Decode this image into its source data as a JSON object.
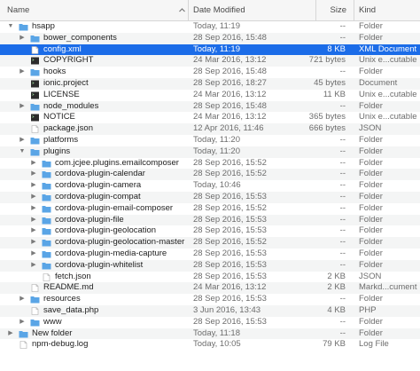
{
  "columns": {
    "name": "Name",
    "date": "Date Modified",
    "size": "Size",
    "kind": "Kind"
  },
  "rows": [
    {
      "name": "hsapp",
      "date": "Today, 11:19",
      "size": "--",
      "kind": "Folder",
      "icon": "folder-icon",
      "depth": 0,
      "expander": "open"
    },
    {
      "name": "bower_components",
      "date": "28 Sep 2016, 15:48",
      "size": "--",
      "kind": "Folder",
      "icon": "folder-icon",
      "depth": 1,
      "expander": "closed"
    },
    {
      "name": "config.xml",
      "date": "Today, 11:19",
      "size": "8 KB",
      "kind": "XML Document",
      "icon": "document-icon",
      "depth": 1,
      "expander": "none",
      "selected": true
    },
    {
      "name": "COPYRIGHT",
      "date": "24 Mar 2016, 13:12",
      "size": "721 bytes",
      "kind": "Unix e...cutable",
      "icon": "terminal-icon",
      "depth": 1,
      "expander": "none"
    },
    {
      "name": "hooks",
      "date": "28 Sep 2016, 15:48",
      "size": "--",
      "kind": "Folder",
      "icon": "folder-icon",
      "depth": 1,
      "expander": "closed"
    },
    {
      "name": "ionic.project",
      "date": "28 Sep 2016, 18:27",
      "size": "45 bytes",
      "kind": "Document",
      "icon": "terminal-icon",
      "depth": 1,
      "expander": "none"
    },
    {
      "name": "LICENSE",
      "date": "24 Mar 2016, 13:12",
      "size": "11 KB",
      "kind": "Unix e...cutable",
      "icon": "terminal-icon",
      "depth": 1,
      "expander": "none"
    },
    {
      "name": "node_modules",
      "date": "28 Sep 2016, 15:48",
      "size": "--",
      "kind": "Folder",
      "icon": "folder-icon",
      "depth": 1,
      "expander": "closed"
    },
    {
      "name": "NOTICE",
      "date": "24 Mar 2016, 13:12",
      "size": "365 bytes",
      "kind": "Unix e...cutable",
      "icon": "terminal-icon",
      "depth": 1,
      "expander": "none"
    },
    {
      "name": "package.json",
      "date": "12 Apr 2016, 11:46",
      "size": "666 bytes",
      "kind": "JSON",
      "icon": "document-icon",
      "depth": 1,
      "expander": "none"
    },
    {
      "name": "platforms",
      "date": "Today, 11:20",
      "size": "--",
      "kind": "Folder",
      "icon": "folder-icon",
      "depth": 1,
      "expander": "closed"
    },
    {
      "name": "plugins",
      "date": "Today, 11:20",
      "size": "--",
      "kind": "Folder",
      "icon": "folder-icon",
      "depth": 1,
      "expander": "open"
    },
    {
      "name": "com.jcjee.plugins.emailcomposer",
      "date": "28 Sep 2016, 15:52",
      "size": "--",
      "kind": "Folder",
      "icon": "folder-icon",
      "depth": 2,
      "expander": "closed"
    },
    {
      "name": "cordova-plugin-calendar",
      "date": "28 Sep 2016, 15:52",
      "size": "--",
      "kind": "Folder",
      "icon": "folder-icon",
      "depth": 2,
      "expander": "closed"
    },
    {
      "name": "cordova-plugin-camera",
      "date": "Today, 10:46",
      "size": "--",
      "kind": "Folder",
      "icon": "folder-icon",
      "depth": 2,
      "expander": "closed"
    },
    {
      "name": "cordova-plugin-compat",
      "date": "28 Sep 2016, 15:53",
      "size": "--",
      "kind": "Folder",
      "icon": "folder-icon",
      "depth": 2,
      "expander": "closed"
    },
    {
      "name": "cordova-plugin-email-composer",
      "date": "28 Sep 2016, 15:52",
      "size": "--",
      "kind": "Folder",
      "icon": "folder-icon",
      "depth": 2,
      "expander": "closed"
    },
    {
      "name": "cordova-plugin-file",
      "date": "28 Sep 2016, 15:53",
      "size": "--",
      "kind": "Folder",
      "icon": "folder-icon",
      "depth": 2,
      "expander": "closed"
    },
    {
      "name": "cordova-plugin-geolocation",
      "date": "28 Sep 2016, 15:53",
      "size": "--",
      "kind": "Folder",
      "icon": "folder-icon",
      "depth": 2,
      "expander": "closed"
    },
    {
      "name": "cordova-plugin-geolocation-master",
      "date": "28 Sep 2016, 15:52",
      "size": "--",
      "kind": "Folder",
      "icon": "folder-icon",
      "depth": 2,
      "expander": "closed"
    },
    {
      "name": "cordova-plugin-media-capture",
      "date": "28 Sep 2016, 15:53",
      "size": "--",
      "kind": "Folder",
      "icon": "folder-icon",
      "depth": 2,
      "expander": "closed"
    },
    {
      "name": "cordova-plugin-whitelist",
      "date": "28 Sep 2016, 15:53",
      "size": "--",
      "kind": "Folder",
      "icon": "folder-icon",
      "depth": 2,
      "expander": "closed"
    },
    {
      "name": "fetch.json",
      "date": "28 Sep 2016, 15:53",
      "size": "2 KB",
      "kind": "JSON",
      "icon": "document-icon",
      "depth": 2,
      "expander": "none"
    },
    {
      "name": "README.md",
      "date": "24 Mar 2016, 13:12",
      "size": "2 KB",
      "kind": "Markd...cument",
      "icon": "document-icon",
      "depth": 1,
      "expander": "none"
    },
    {
      "name": "resources",
      "date": "28 Sep 2016, 15:53",
      "size": "--",
      "kind": "Folder",
      "icon": "folder-icon",
      "depth": 1,
      "expander": "closed"
    },
    {
      "name": "save_data.php",
      "date": "3 Jun 2016, 13:43",
      "size": "4 KB",
      "kind": "PHP",
      "icon": "document-icon",
      "depth": 1,
      "expander": "none"
    },
    {
      "name": "www",
      "date": "28 Sep 2016, 15:53",
      "size": "--",
      "kind": "Folder",
      "icon": "folder-icon",
      "depth": 1,
      "expander": "closed"
    },
    {
      "name": "New folder",
      "date": "Today, 11:18",
      "size": "--",
      "kind": "Folder",
      "icon": "folder-icon",
      "depth": 0,
      "expander": "closed"
    },
    {
      "name": "npm-debug.log",
      "date": "Today, 10:05",
      "size": "79 KB",
      "kind": "Log File",
      "icon": "document-icon",
      "depth": 0,
      "expander": "none"
    }
  ],
  "colors": {
    "selection": "#1b6ce8",
    "folder": "#5aa5e6",
    "stripe": "#f4f5f5"
  }
}
